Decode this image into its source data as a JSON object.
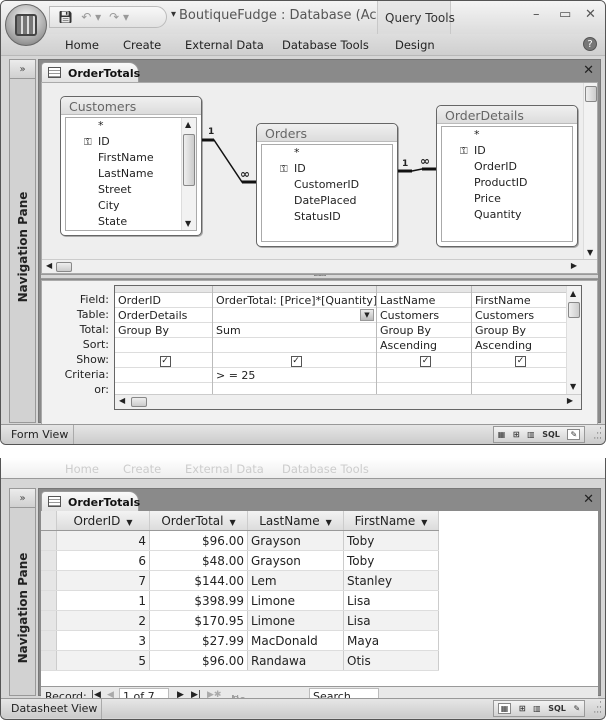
{
  "window1": {
    "title": "BoutiqueFudge : Database (Ac...",
    "contextual_tab_group": "Query Tools",
    "ribbon_tabs": [
      "Home",
      "Create",
      "External Data",
      "Database Tools",
      "Design"
    ],
    "window_controls": {
      "minimize": "–",
      "maximize": "▭",
      "close": "✕"
    },
    "help": "?",
    "nav_pane": {
      "expand": "»",
      "label": "Navigation Pane"
    },
    "doc_tab": "OrderTotals",
    "close_doc": "✕",
    "tables": [
      {
        "name": "Customers",
        "fields": [
          "*",
          "ID",
          "FirstName",
          "LastName",
          "Street",
          "City",
          "State"
        ],
        "key_field": "ID"
      },
      {
        "name": "Orders",
        "fields": [
          "*",
          "ID",
          "CustomerID",
          "DatePlaced",
          "StatusID"
        ],
        "key_field": "ID"
      },
      {
        "name": "OrderDetails",
        "fields": [
          "*",
          "ID",
          "OrderID",
          "ProductID",
          "Price",
          "Quantity"
        ],
        "key_field": "ID"
      }
    ],
    "relationships": [
      {
        "from": "Customers",
        "to": "Orders",
        "one": "1",
        "many": "∞"
      },
      {
        "from": "Orders",
        "to": "OrderDetails",
        "one": "1",
        "many": "∞"
      }
    ],
    "grid": {
      "row_labels": [
        "Field:",
        "Table:",
        "Total:",
        "Sort:",
        "Show:",
        "Criteria:",
        "or:"
      ],
      "columns": [
        {
          "field": "OrderID",
          "table": "OrderDetails",
          "total": "Group By",
          "sort": "",
          "show": true,
          "criteria": "",
          "or": ""
        },
        {
          "field": "OrderTotal: [Price]*[Quantity]",
          "table": "",
          "total": "Sum",
          "sort": "",
          "show": true,
          "criteria": "> = 25",
          "or": ""
        },
        {
          "field": "LastName",
          "table": "Customers",
          "total": "Group By",
          "sort": "Ascending",
          "show": true,
          "criteria": "",
          "or": ""
        },
        {
          "field": "FirstName",
          "table": "Customers",
          "total": "Group By",
          "sort": "Ascending",
          "show": true,
          "criteria": "",
          "or": ""
        }
      ]
    },
    "status": "Form View",
    "views": [
      "datasheet-view",
      "pivottable-view",
      "pivotchart-view",
      "SQL",
      "design-view"
    ]
  },
  "window2": {
    "ghost_tabs": [
      "Home",
      "Create",
      "External Data",
      "Database Tools"
    ],
    "nav_pane": {
      "expand": "»",
      "label": "Navigation Pane"
    },
    "doc_tab": "OrderTotals",
    "close_doc": "✕",
    "datasheet": {
      "columns": [
        "OrderID",
        "OrderTotal",
        "LastName",
        "FirstName"
      ],
      "rows": [
        [
          "4",
          "$96.00",
          "Grayson",
          "Toby"
        ],
        [
          "6",
          "$48.00",
          "Grayson",
          "Toby"
        ],
        [
          "7",
          "$144.00",
          "Lem",
          "Stanley"
        ],
        [
          "1",
          "$398.99",
          "Limone",
          "Lisa"
        ],
        [
          "2",
          "$170.95",
          "Limone",
          "Lisa"
        ],
        [
          "3",
          "$27.99",
          "MacDonald",
          "Maya"
        ],
        [
          "5",
          "$96.00",
          "Randawa",
          "Otis"
        ]
      ]
    },
    "record_nav": {
      "label": "Record:",
      "position": "1 of 7",
      "filter": "No Filter",
      "search": "Search"
    },
    "status": "Datasheet View"
  }
}
